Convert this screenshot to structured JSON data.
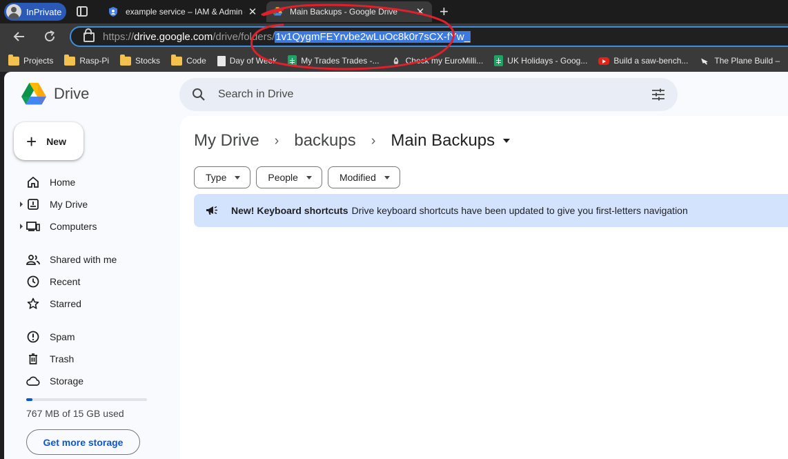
{
  "browser": {
    "profile_label": "InPrivate",
    "tabs": [
      {
        "title": "example service – IAM & Admin – ",
        "close": "✕",
        "icon": "shield-icon"
      },
      {
        "title": "Main Backups - Google Drive",
        "close": "✕",
        "icon": "google-drive-icon"
      }
    ],
    "new_tab": "+",
    "url": {
      "protocol": "https://",
      "host": "drive.google.com",
      "path": "/drive/folders/",
      "selected_id": "1v1QygmFEYrvbe2wLuOc8k0r7sCX-fYw_"
    },
    "bookmarks": [
      {
        "label": "Projects",
        "icon": "folder"
      },
      {
        "label": "Rasp-Pi",
        "icon": "folder"
      },
      {
        "label": "Stocks",
        "icon": "folder"
      },
      {
        "label": "Code",
        "icon": "folder"
      },
      {
        "label": "Day of Week",
        "icon": "page"
      },
      {
        "label": "My Trades Trades -...",
        "icon": "sheet"
      },
      {
        "label": "Check my EuroMilli...",
        "icon": "lottery"
      },
      {
        "label": "UK Holidays - Goog...",
        "icon": "sheet"
      },
      {
        "label": "Build a saw-bench...",
        "icon": "youtube"
      },
      {
        "label": "The Plane Build –",
        "icon": "plane"
      }
    ],
    "annotation_color": "#e0202a"
  },
  "drive": {
    "logo_text": "Drive",
    "search_placeholder": "Search in Drive",
    "new_button": "New",
    "nav": {
      "home": "Home",
      "my_drive": "My Drive",
      "computers": "Computers",
      "shared": "Shared with me",
      "recent": "Recent",
      "starred": "Starred",
      "spam": "Spam",
      "trash": "Trash",
      "storage": "Storage"
    },
    "storage_used_text": "767 MB of 15 GB used",
    "storage_used_fraction": 0.05,
    "get_storage_button": "Get more storage",
    "breadcrumb": {
      "root": "My Drive",
      "parent": "backups",
      "current": "Main Backups",
      "separator": "›"
    },
    "filters": [
      "Type",
      "People",
      "Modified"
    ],
    "banner": {
      "title": "New! Keyboard shortcuts",
      "message": "Drive keyboard shortcuts have been updated to give you first-letters navigation"
    },
    "accent_color": "#0b57d0",
    "banner_color": "#d3e3fd"
  }
}
